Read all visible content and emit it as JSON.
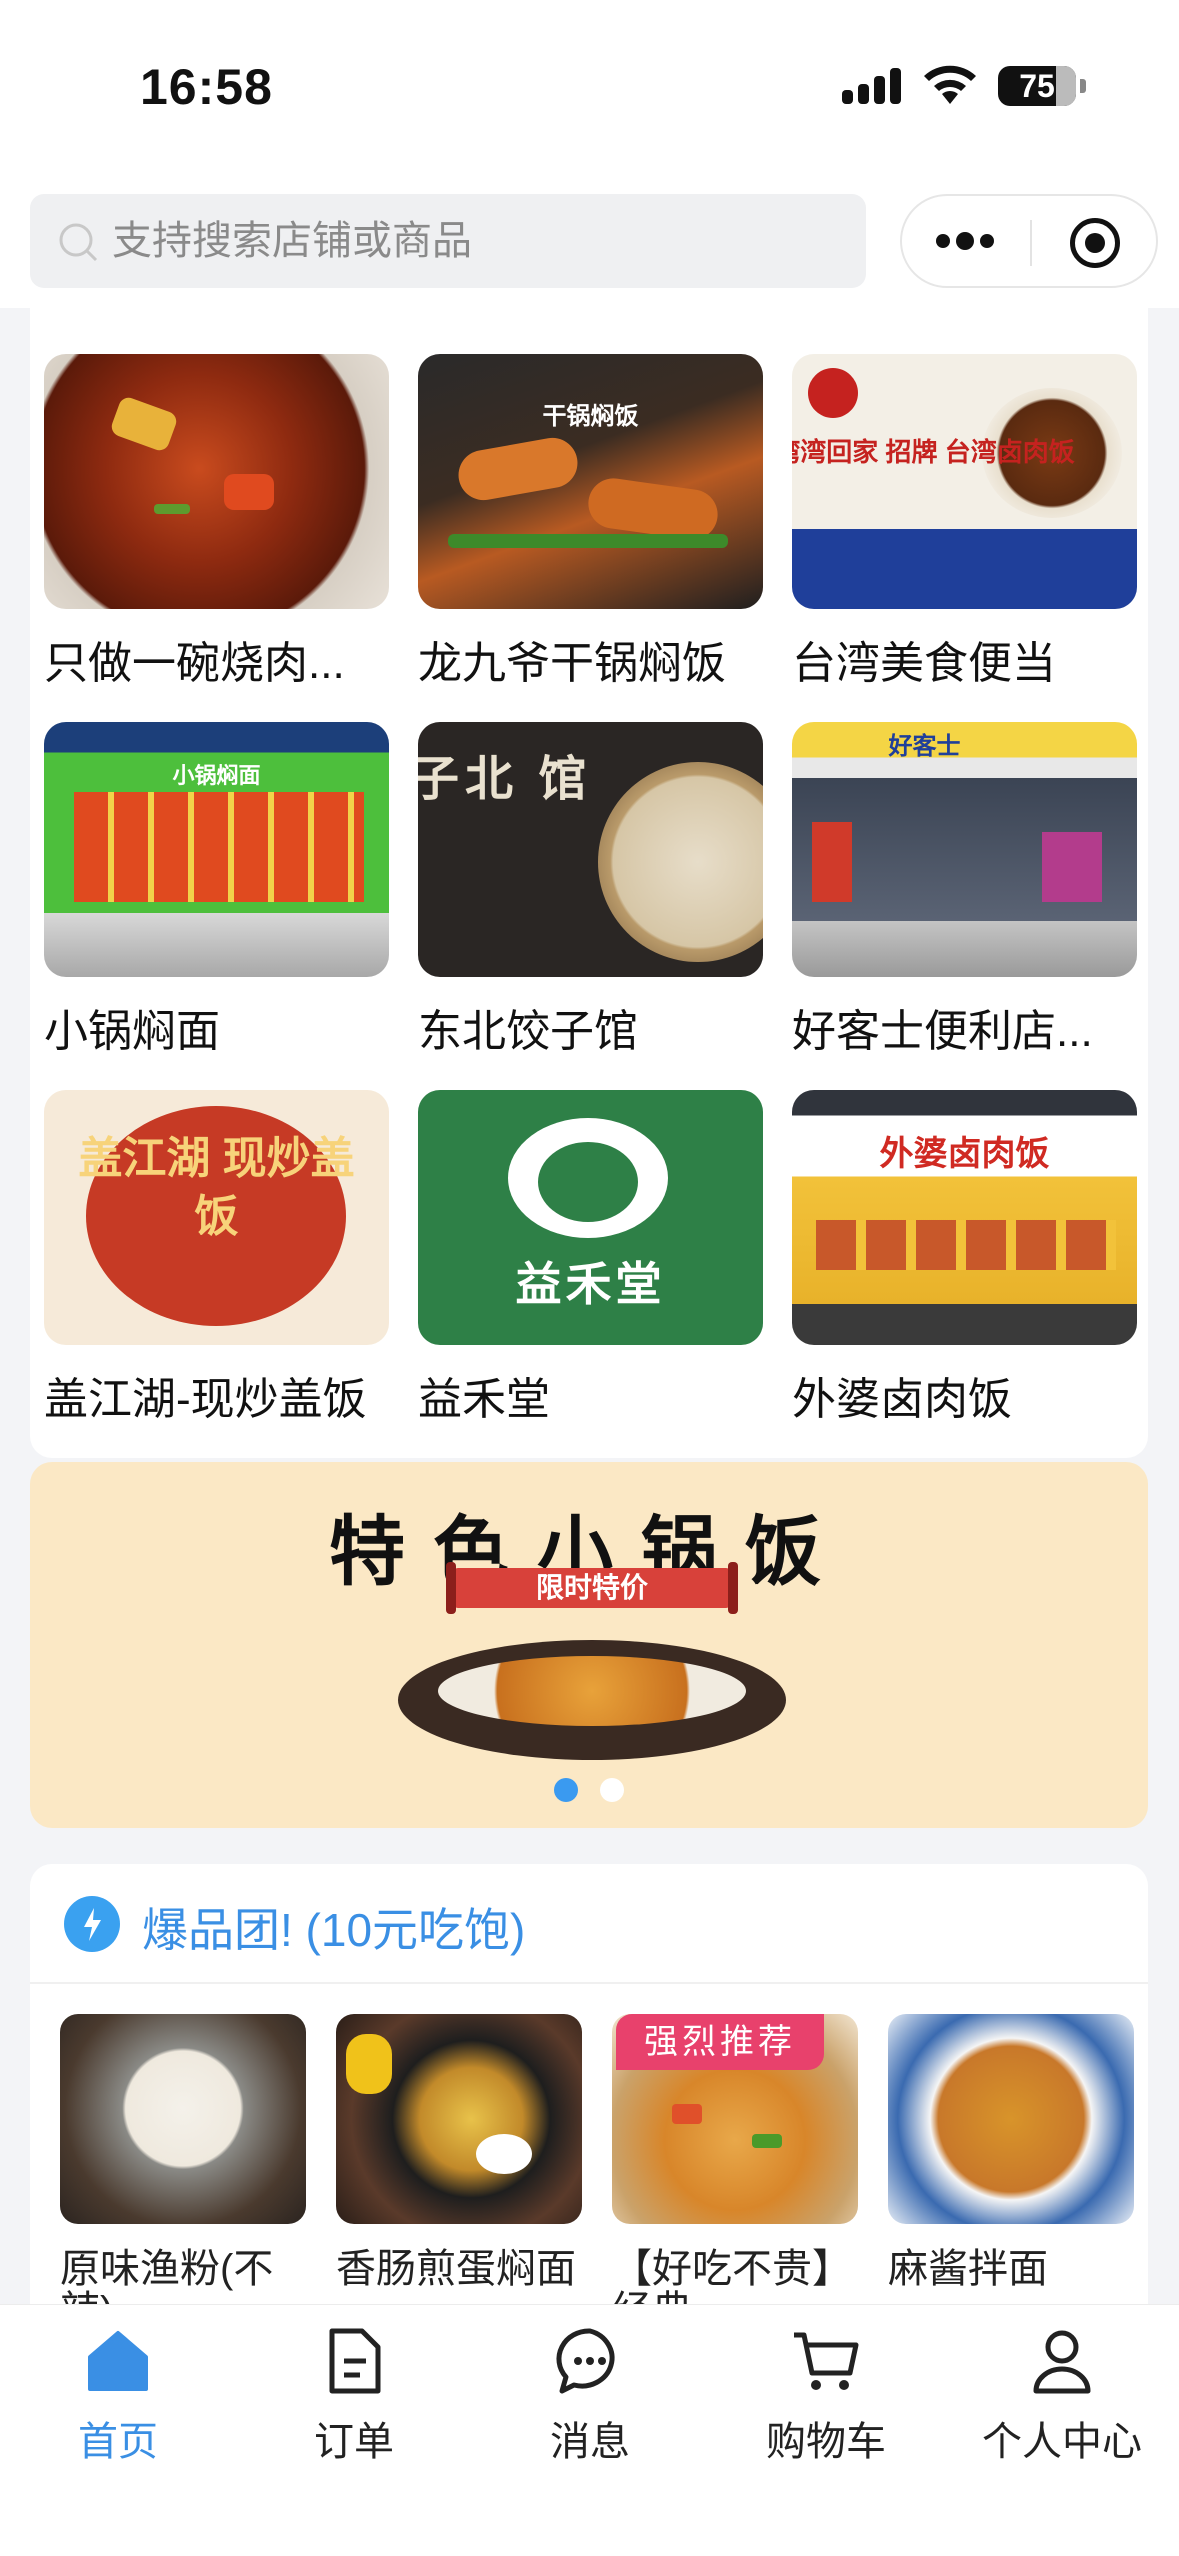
{
  "status_bar": {
    "time": "16:58",
    "battery": "75"
  },
  "search": {
    "placeholder": "支持搜索店铺或商品"
  },
  "shops": [
    {
      "name": "只做一碗烧肉...",
      "overlay": ""
    },
    {
      "name": "龙九爷干锅焖饭",
      "overlay": "干锅焖饭"
    },
    {
      "name": "台湾美食便当",
      "overlay": "湾湾回家  招牌 台湾卤肉饭"
    },
    {
      "name": "小锅焖面",
      "overlay": "小锅焖面"
    },
    {
      "name": "东北饺子馆",
      "overlay": "饺东 子北 馆"
    },
    {
      "name": "好客士便利店...",
      "overlay": "好客士"
    },
    {
      "name": "盖江湖-现炒盖饭",
      "overlay": "盖江湖 现炒盖饭"
    },
    {
      "name": "益禾堂",
      "overlay": "益禾堂"
    },
    {
      "name": "外婆卤肉饭",
      "overlay": "外婆卤肉饭"
    }
  ],
  "banner": {
    "title": "特色小锅饭",
    "ribbon": "限时特价",
    "active_slide": 1,
    "slide_count": 2
  },
  "group_buy": {
    "title": "爆品团!  (10元吃饱)",
    "tag": "强烈推荐",
    "items": [
      {
        "name": "原味渔粉(不辣)"
      },
      {
        "name": "香肠煎蛋焖面"
      },
      {
        "name": "【好吃不贵】经典"
      },
      {
        "name": "麻酱拌面"
      }
    ]
  },
  "tabbar": [
    {
      "label": "首页",
      "icon": "home-icon",
      "active": true
    },
    {
      "label": "订单",
      "icon": "order-icon",
      "active": false
    },
    {
      "label": "消息",
      "icon": "message-icon",
      "active": false
    },
    {
      "label": "购物车",
      "icon": "cart-icon",
      "active": false
    },
    {
      "label": "个人中心",
      "icon": "profile-icon",
      "active": false
    }
  ],
  "colors": {
    "accent": "#3a8fe4",
    "tag": "#e8416c",
    "banner_bg": "#fbe8c5"
  }
}
